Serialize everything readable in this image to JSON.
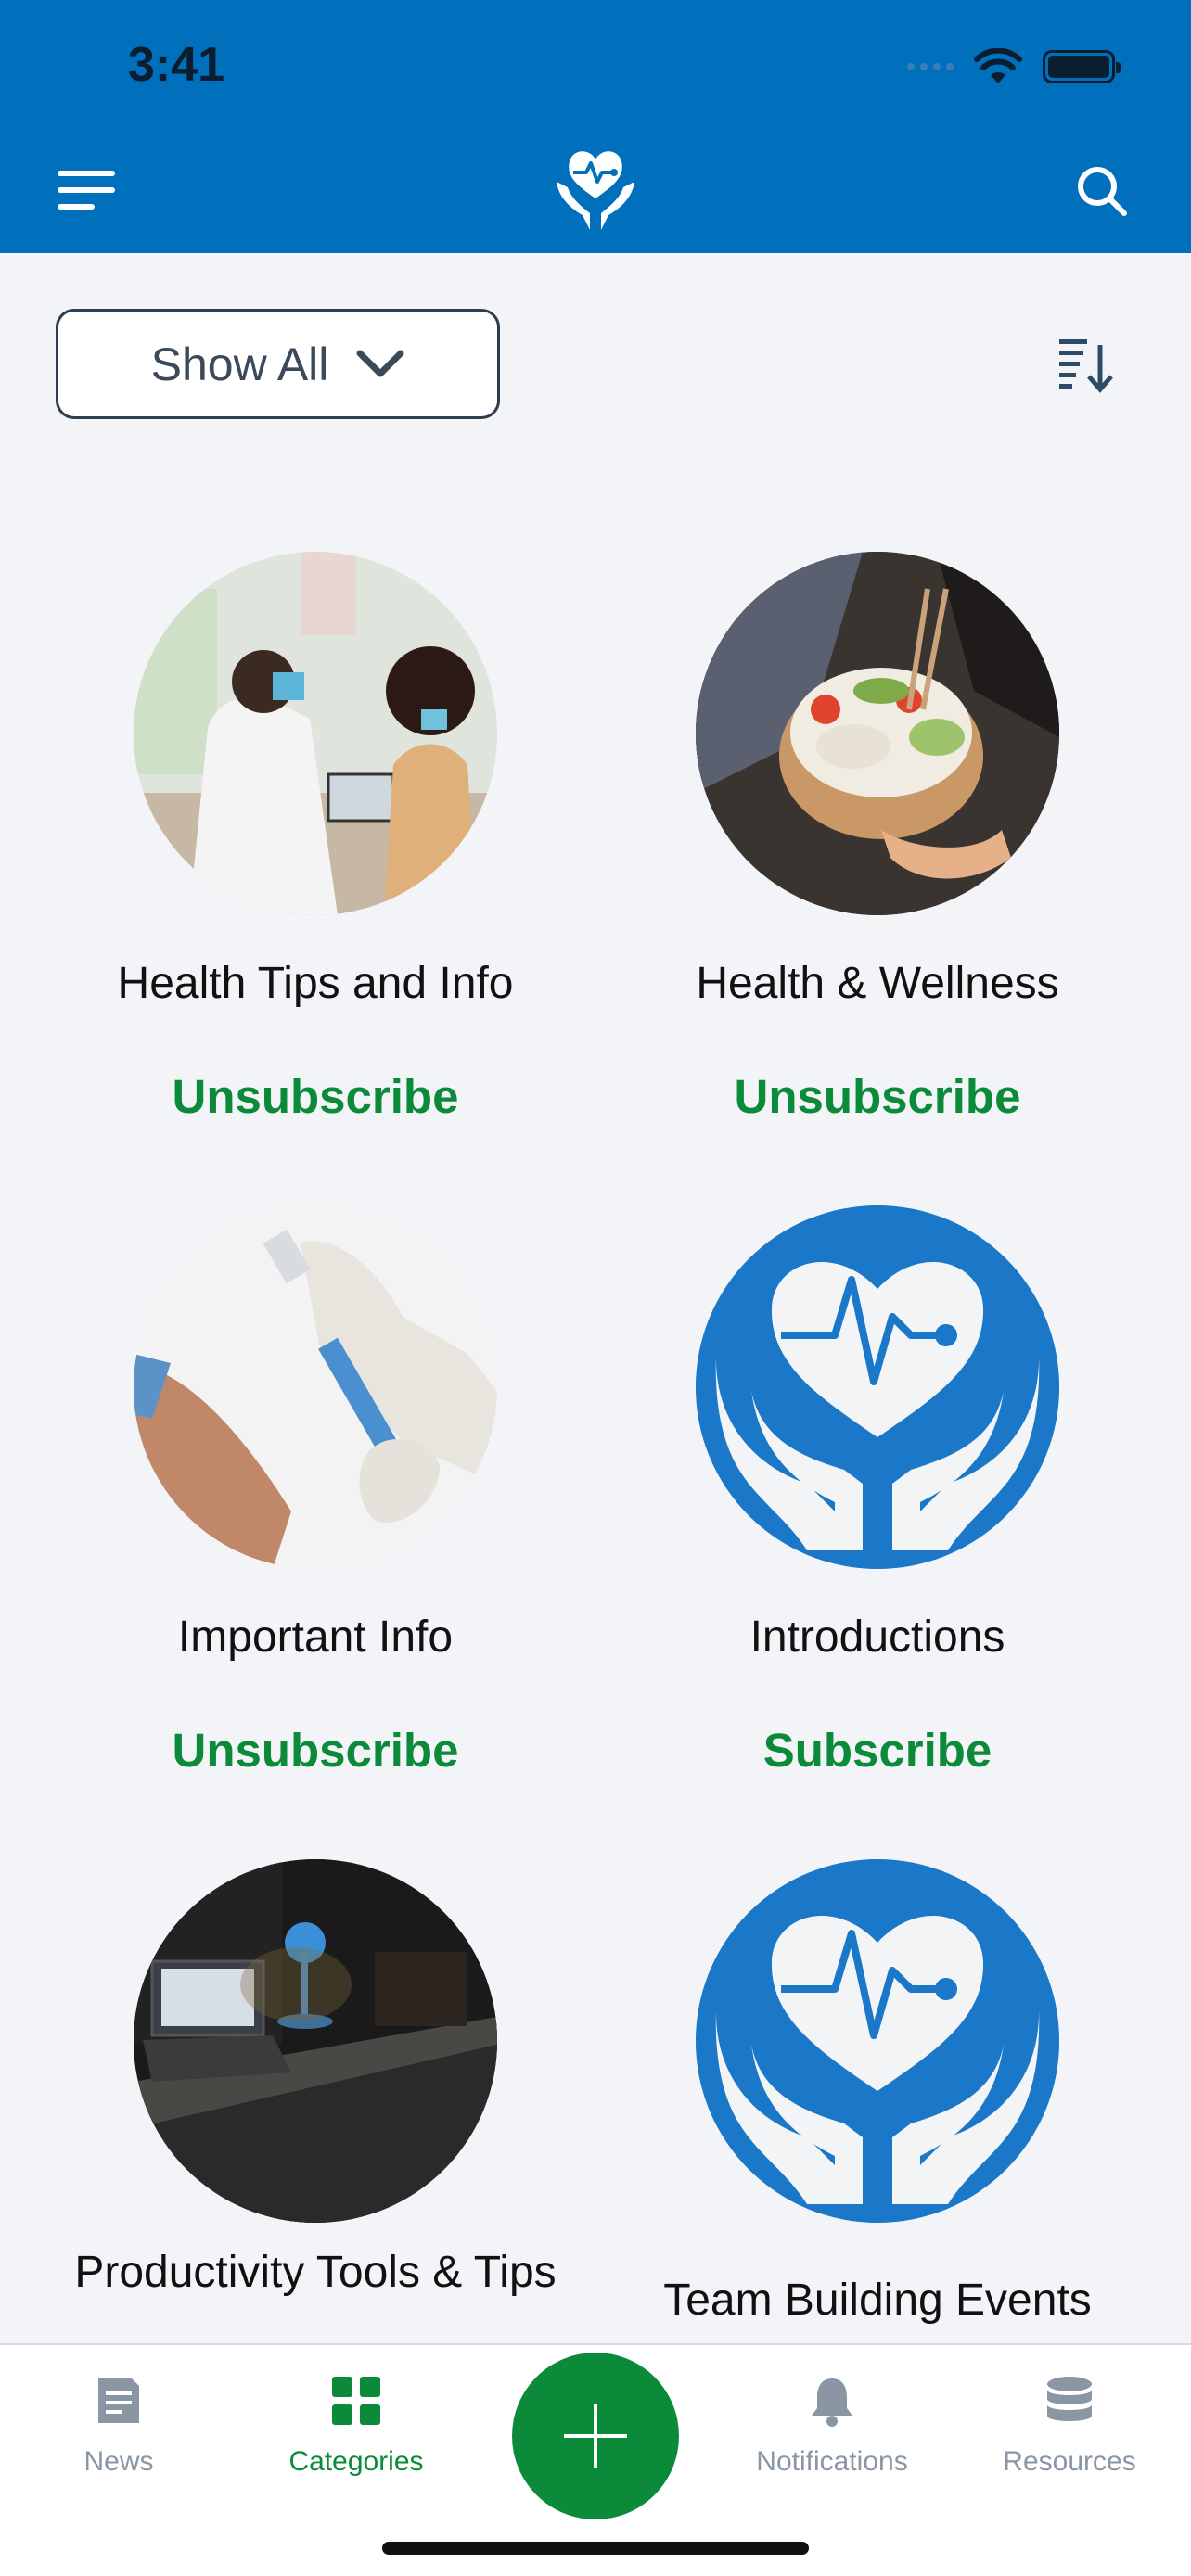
{
  "status_bar": {
    "time": "3:41"
  },
  "header": {
    "logo_icon": "heart-hands-logo",
    "menu_icon": "menu-icon",
    "search_icon": "search-icon",
    "color": "#0070bc"
  },
  "toolbar": {
    "filter_value": "Show All",
    "sort_icon": "sort-icon"
  },
  "categories": [
    {
      "title": "Health Tips and Info",
      "action": "Unsubscribe"
    },
    {
      "title": "Health & Wellness",
      "action": "Unsubscribe"
    },
    {
      "title": "Important Info",
      "action": "Unsubscribe"
    },
    {
      "title": "Introductions",
      "action": "Subscribe"
    },
    {
      "title": "Productivity Tools & Tips",
      "action": ""
    },
    {
      "title": "Team Building Events",
      "action": ""
    }
  ],
  "tabbar": {
    "tabs": [
      {
        "label": "News",
        "icon": "news-icon"
      },
      {
        "label": "Categories",
        "icon": "categories-icon",
        "active": true
      },
      {
        "label": "Notifications",
        "icon": "bell-icon"
      },
      {
        "label": "Resources",
        "icon": "database-icon"
      }
    ],
    "fab_icon": "plus-icon"
  },
  "colors": {
    "accent_green": "#0b8a3a",
    "brand_blue": "#0070bc"
  }
}
